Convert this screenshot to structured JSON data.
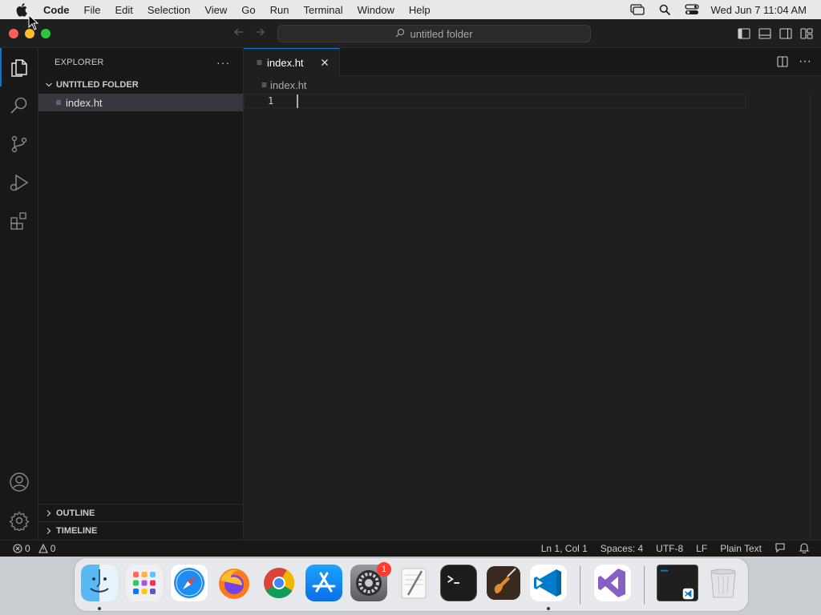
{
  "menubar": {
    "app_name": "Code",
    "items": [
      "File",
      "Edit",
      "Selection",
      "View",
      "Go",
      "Run",
      "Terminal",
      "Window",
      "Help"
    ],
    "clock": "Wed Jun 7  11:04 AM",
    "icons": [
      "screen-mirroring-icon",
      "spotlight-search-icon",
      "control-center-icon"
    ]
  },
  "titlebar": {
    "command_center": "untitled folder"
  },
  "activitybar": {
    "items": [
      "explorer-icon",
      "search-icon",
      "source-control-icon",
      "run-debug-icon",
      "extensions-icon"
    ],
    "bottom": [
      "accounts-icon",
      "manage-gear-icon"
    ]
  },
  "sidebar": {
    "title": "EXPLORER",
    "folder": "UNTITLED FOLDER",
    "files": [
      {
        "name": "index.ht",
        "selected": true
      }
    ],
    "sections": [
      "OUTLINE",
      "TIMELINE"
    ]
  },
  "editor": {
    "tab_label": "index.ht",
    "breadcrumb": "index.ht",
    "line_numbers": [
      "1"
    ]
  },
  "statusbar": {
    "errors": "0",
    "warnings": "0",
    "position": "Ln 1, Col 1",
    "spaces": "Spaces: 4",
    "encoding": "UTF-8",
    "eol": "LF",
    "language": "Plain Text"
  },
  "dock": {
    "apps": [
      "Finder",
      "Launchpad",
      "Safari",
      "Firefox",
      "Chrome",
      "App Store",
      "System Settings",
      "TextEdit",
      "Terminal",
      "GarageBand",
      "Visual Studio Code",
      "Visual Studio",
      "Screen Recording",
      "Trash"
    ],
    "system_settings_badge": "1"
  },
  "colors": {
    "accent": "#0078d4",
    "editor_bg": "#1f1f1f",
    "sidebar_bg": "#181818"
  }
}
